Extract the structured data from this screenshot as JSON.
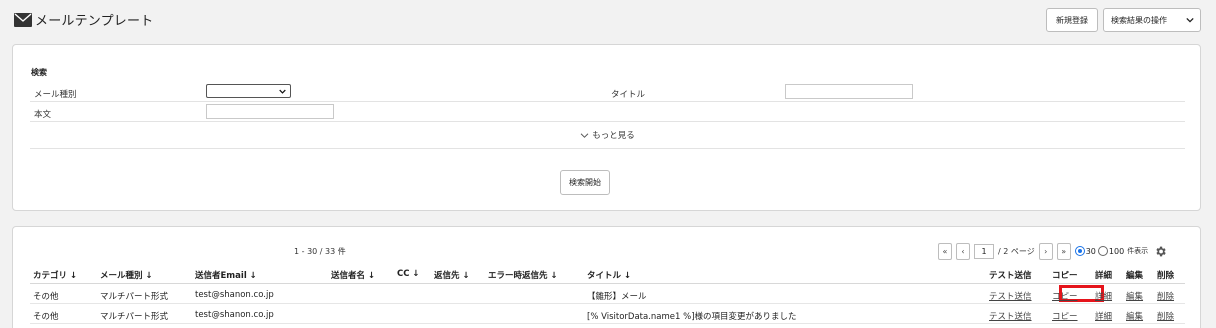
{
  "header": {
    "title": "メールテンプレート",
    "new_button": "新規登録",
    "ops_select": "検索結果の操作"
  },
  "search": {
    "section_label": "検索",
    "mail_type_label": "メール種別",
    "mail_type_value": "",
    "title_label": "タイトル",
    "title_value": "",
    "body_label": "本文",
    "body_value": "",
    "more_label": "もっと見る",
    "start_button": "検索開始"
  },
  "list": {
    "count": "1 - 30 / 33 件",
    "pager": {
      "first": "«",
      "prev": "‹",
      "page": "1",
      "total": "/ 2 ページ",
      "next": "›",
      "last": "»"
    },
    "per_page": {
      "options": [
        "30",
        "100"
      ],
      "selected": "30",
      "suffix": "件表示"
    },
    "columns": [
      "カテゴリ ↓",
      "メール種別 ↓",
      "送信者Email ↓",
      "送信者名 ↓",
      "CC ↓",
      "返信先 ↓",
      "エラー時返信先 ↓",
      "タイトル ↓",
      "テスト送信",
      "コピー",
      "詳細",
      "編集",
      "削除"
    ],
    "rows": [
      {
        "category": "その他",
        "mail_type": "マルチパート形式",
        "sender_email": "test@shanon.co.jp",
        "title": "【雛形】メール",
        "test": "テスト送信",
        "copy": "コピー",
        "detail": "詳細",
        "edit": "編集",
        "delete": "削除"
      },
      {
        "category": "その他",
        "mail_type": "マルチパート形式",
        "sender_email": "test@shanon.co.jp",
        "title": "[% VisitorData.name1 %]様の項目変更がありました",
        "test": "テスト送信",
        "copy": "コピー",
        "detail": "詳細",
        "edit": "編集",
        "delete": "削除"
      }
    ]
  },
  "colors": {
    "highlight": "#e5141b",
    "radio_selected": "#1a73e8"
  }
}
